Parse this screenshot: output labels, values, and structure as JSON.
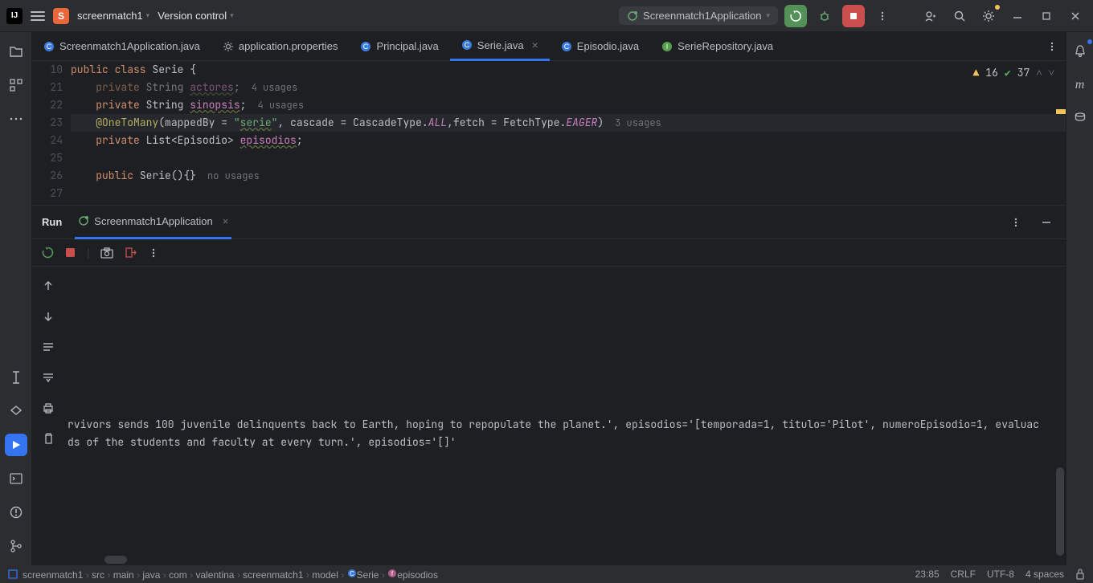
{
  "topbar": {
    "project_initial": "S",
    "project_name": "screenmatch1",
    "vcs_label": "Version control",
    "run_config": "Screenmatch1Application"
  },
  "tabs": [
    {
      "label": "Screenmatch1Application.java",
      "icon": "class",
      "active": false
    },
    {
      "label": "application.properties",
      "icon": "gear",
      "active": false
    },
    {
      "label": "Principal.java",
      "icon": "class",
      "active": false
    },
    {
      "label": "Serie.java",
      "icon": "class",
      "active": true
    },
    {
      "label": "Episodio.java",
      "icon": "class",
      "active": false
    },
    {
      "label": "SerieRepository.java",
      "icon": "interface",
      "active": false
    }
  ],
  "editor_status": {
    "warnings": "16",
    "passes": "37"
  },
  "code": {
    "lines": [
      {
        "n": "10",
        "seg": [
          {
            "t": "public ",
            "c": "kw"
          },
          {
            "t": "class ",
            "c": "kw"
          },
          {
            "t": "Serie ",
            "c": "cls"
          },
          {
            "t": "{",
            "c": "op"
          }
        ]
      },
      {
        "n": "21",
        "seg": [
          {
            "t": "    ",
            "c": ""
          },
          {
            "t": "private",
            "c": "kw dim"
          },
          {
            "t": " String ",
            "c": "type dim"
          },
          {
            "t": "actores",
            "c": "field dim"
          },
          {
            "t": ";",
            "c": "op dim"
          }
        ],
        "hint": "4 usages"
      },
      {
        "n": "22",
        "seg": [
          {
            "t": "    ",
            "c": ""
          },
          {
            "t": "private",
            "c": "kw"
          },
          {
            "t": " String ",
            "c": "type"
          },
          {
            "t": "sinopsis",
            "c": "field"
          },
          {
            "t": ";",
            "c": "op"
          }
        ],
        "hint": "4 usages"
      },
      {
        "n": "23",
        "hl": true,
        "seg": [
          {
            "t": "    ",
            "c": ""
          },
          {
            "t": "@OneToMany",
            "c": "ann"
          },
          {
            "t": "(",
            "c": "op"
          },
          {
            "t": "mappedBy = ",
            "c": "type"
          },
          {
            "t": "\"",
            "c": "str"
          },
          {
            "t": "serie",
            "c": "str u"
          },
          {
            "t": "\"",
            "c": "str"
          },
          {
            "t": ", cascade = CascadeType.",
            "c": "type"
          },
          {
            "t": "ALL",
            "c": "const"
          },
          {
            "t": ",fetch = FetchType.",
            "c": "type"
          },
          {
            "t": "EAGER",
            "c": "const"
          },
          {
            "t": ")",
            "c": "op"
          }
        ],
        "hint": "3 usages"
      },
      {
        "n": "24",
        "seg": [
          {
            "t": "    ",
            "c": ""
          },
          {
            "t": "private",
            "c": "kw"
          },
          {
            "t": " List<Episodio> ",
            "c": "type"
          },
          {
            "t": "episodios",
            "c": "field"
          },
          {
            "t": ";",
            "c": "op"
          }
        ]
      },
      {
        "n": "25",
        "seg": []
      },
      {
        "n": "26",
        "seg": [
          {
            "t": "    ",
            "c": ""
          },
          {
            "t": "public",
            "c": "kw"
          },
          {
            "t": " ",
            "c": ""
          },
          {
            "t": "Serie",
            "c": "cls"
          },
          {
            "t": "(){}",
            "c": "op"
          }
        ],
        "hint": "no usages"
      },
      {
        "n": "27",
        "seg": []
      }
    ]
  },
  "run": {
    "title": "Run",
    "tab": "Screenmatch1Application",
    "output": [
      "rvivors sends 100 juvenile delinquents back to Earth, hoping to repopulate the planet.', episodios='[temporada=1, titulo='Pilot', numeroEpisodio=1, evaluac",
      "ds of the students and faculty at every turn.', episodios='[]'"
    ]
  },
  "breadcrumb": {
    "parts": [
      "screenmatch1",
      "src",
      "main",
      "java",
      "com",
      "valentina",
      "screenmatch1",
      "model",
      "Serie",
      "episodios"
    ],
    "position": "23:85",
    "line_sep": "CRLF",
    "encoding": "UTF-8",
    "indent": "4 spaces"
  }
}
